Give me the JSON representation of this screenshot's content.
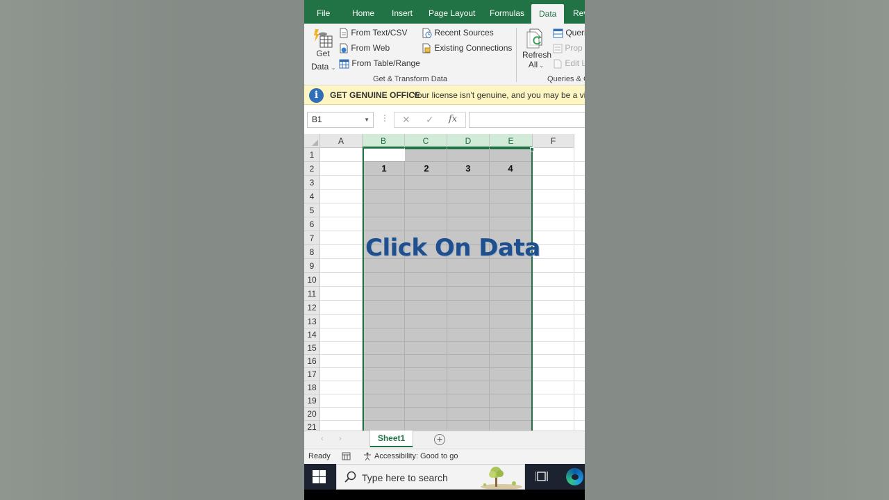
{
  "ribbon_tabs": [
    "File",
    "Home",
    "Insert",
    "Page Layout",
    "Formulas",
    "Data",
    "Rev"
  ],
  "active_tab": "Data",
  "get_transform": {
    "get_data": [
      "Get",
      "Data"
    ],
    "from_text_csv": "From Text/CSV",
    "from_web": "From Web",
    "from_table_range": "From Table/Range",
    "recent_sources": "Recent Sources",
    "existing_connections": "Existing Connections",
    "group_label": "Get & Transform Data"
  },
  "queries_group": {
    "refresh_all": [
      "Refresh",
      "All"
    ],
    "queries": "Queri",
    "properties": "Prop",
    "edit_links": "Edit L",
    "group_label": "Queries & C"
  },
  "license_bar": {
    "title": "GET GENUINE OFFICE",
    "message": "Your license isn't genuine, and you may be a victi"
  },
  "name_box": "B1",
  "formula_icons": {
    "cancel": "✕",
    "enter": "✓",
    "fx": "fx"
  },
  "columns": [
    "A",
    "B",
    "C",
    "D",
    "E",
    "F"
  ],
  "rows": [
    "1",
    "2",
    "3",
    "4",
    "5",
    "6",
    "7",
    "8",
    "9",
    "10",
    "11",
    "12",
    "13",
    "14",
    "15",
    "16",
    "17",
    "18",
    "19",
    "20",
    "21"
  ],
  "cells": {
    "B2": "1",
    "C2": "2",
    "D2": "3",
    "E2": "4"
  },
  "overlay_caption": "Click On Data",
  "sheet_tab": "Sheet1",
  "status": {
    "ready": "Ready",
    "accessibility": "Accessibility: Good to go"
  },
  "taskbar": {
    "search_placeholder": "Type here to search"
  },
  "colors": {
    "excel_green": "#217346",
    "selection_gray": "#c6c6c6",
    "caption_blue": "#1f4f8c",
    "license_yellow": "#fdf6c3"
  }
}
